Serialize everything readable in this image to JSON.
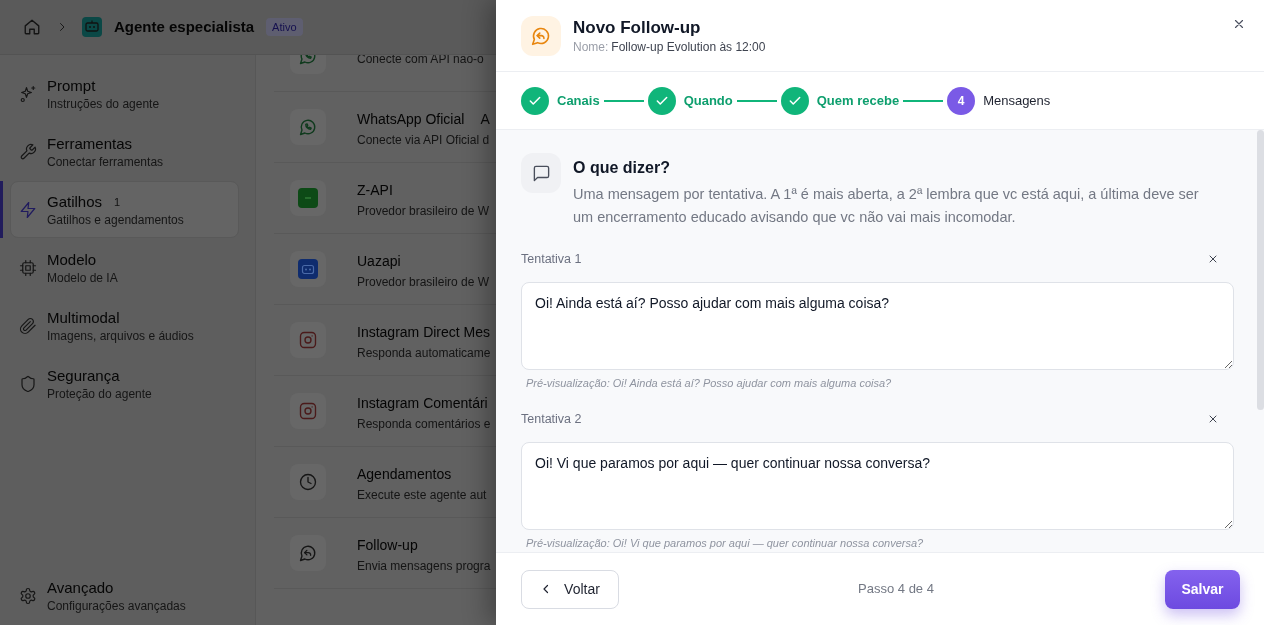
{
  "header": {
    "title": "Agente especialista",
    "status": "Ativo"
  },
  "sidebar": {
    "items": [
      {
        "title": "Prompt",
        "subtitle": "Instruções do agente",
        "selected": false
      },
      {
        "title": "Ferramentas",
        "subtitle": "Conectar ferramentas",
        "selected": false
      },
      {
        "title": "Gatilhos",
        "subtitle": "Gatilhos e agendamentos",
        "count": "1",
        "selected": true
      },
      {
        "title": "Modelo",
        "subtitle": "Modelo de IA",
        "selected": false
      },
      {
        "title": "Multimodal",
        "subtitle": "Imagens, arquivos e áudios",
        "selected": false
      },
      {
        "title": "Segurança",
        "subtitle": "Proteção do agente",
        "selected": false
      }
    ],
    "footer_item": {
      "title": "Avançado",
      "subtitle": "Configurações avançadas"
    }
  },
  "integrations": [
    {
      "subtitle": "Conecte com API não-o"
    },
    {
      "title": "WhatsApp Oficial",
      "tag": "A",
      "subtitle": "Conecte via API Oficial d"
    },
    {
      "title": "Z-API",
      "subtitle": "Provedor brasileiro de W"
    },
    {
      "title": "Uazapi",
      "subtitle": "Provedor brasileiro de W"
    },
    {
      "title": "Instagram Direct Mes",
      "subtitle": "Responda automaticame"
    },
    {
      "title": "Instagram Comentári",
      "subtitle": "Responda comentários e"
    },
    {
      "title": "Agendamentos",
      "subtitle": "Execute este agente aut"
    },
    {
      "title": "Follow-up",
      "subtitle": "Envia mensagens progra"
    }
  ],
  "drawer": {
    "title": "Novo Follow-up",
    "name_label": "Nome:",
    "name_value": "Follow-up Evolution às 12:00",
    "steps": [
      {
        "label": "Canais",
        "completed": true,
        "selected": false
      },
      {
        "label": "Quando",
        "completed": true,
        "selected": false
      },
      {
        "label": "Quem recebe",
        "completed": true,
        "selected": false
      },
      {
        "label": "Mensagens",
        "number": "4",
        "completed": false,
        "selected": true
      }
    ],
    "section": {
      "title": "O que dizer?",
      "description": "Uma mensagem por tentativa. A 1ª é mais aberta, a 2ª lembra que vc está aqui, a última deve ser um encerramento educado avisando que vc não vai mais incomodar."
    },
    "attempts": [
      {
        "label": "Tentativa 1",
        "message": "Oi! Ainda está aí? Posso ajudar com mais alguma coisa?",
        "preview": "Pré-visualização: Oi! Ainda está aí? Posso ajudar com mais alguma coisa?"
      },
      {
        "label": "Tentativa 2",
        "message": "Oi! Vi que paramos por aqui — quer continuar nossa conversa?",
        "preview": "Pré-visualização: Oi! Vi que paramos por aqui — quer continuar nossa conversa?"
      }
    ],
    "footer": {
      "back_button": "Voltar",
      "progress": "Passo 4 de 4",
      "save_button": "Salvar"
    }
  }
}
